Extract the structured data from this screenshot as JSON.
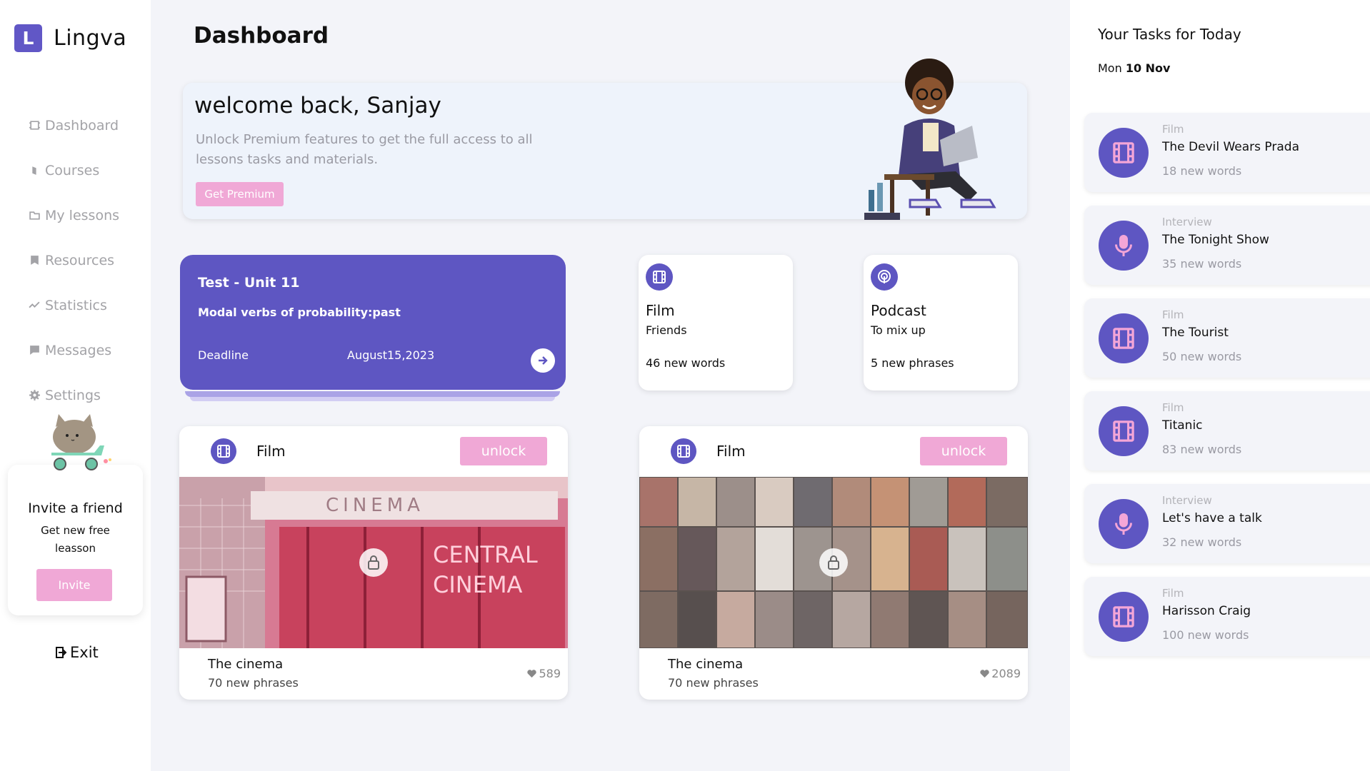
{
  "brand": {
    "letter": "L",
    "name": "Lingva"
  },
  "nav": [
    {
      "label": "Dashboard",
      "icon": "dashboard-icon"
    },
    {
      "label": "Courses",
      "icon": "courses-icon"
    },
    {
      "label": "My lessons",
      "icon": "folder-icon"
    },
    {
      "label": "Resources",
      "icon": "bookmark-icon"
    },
    {
      "label": "Statistics",
      "icon": "chart-icon"
    },
    {
      "label": "Messages",
      "icon": "message-icon"
    },
    {
      "label": "Settings",
      "icon": "gear-icon"
    }
  ],
  "invite": {
    "title": "Invite a friend",
    "subtitle": "Get new free leasson",
    "button": "Invite"
  },
  "exit_label": "Exit",
  "page_title": "Dashboard",
  "welcome": {
    "title": "welcome back, Sanjay",
    "text": "Unlock Premium features to get the full access to all lessons tasks and materials.",
    "button": "Get Premium"
  },
  "test_card": {
    "title": "Test - Unit 11",
    "subtitle": "Modal verbs of probability:past",
    "deadline_label": "Deadline",
    "deadline_date": "August15,2023"
  },
  "mini_cards": [
    {
      "title": "Film",
      "subtitle": "Friends",
      "count": "46 new words",
      "icon": "film-icon"
    },
    {
      "title": "Podcast",
      "subtitle": "To mix up",
      "count": "5 new phrases",
      "icon": "podcast-icon"
    }
  ],
  "film_cards": [
    {
      "label": "Film",
      "unlock": "unlock",
      "title": "The cinema",
      "subtitle": "70 new phrases",
      "likes": "589",
      "image_text_1": "CINEMA",
      "image_text_2": "CENTRAL",
      "image_text_3": "CINEMA"
    },
    {
      "label": "Film",
      "unlock": "unlock",
      "title": "The cinema",
      "subtitle": "70 new phrases",
      "likes": "2089"
    }
  ],
  "tasks_panel": {
    "title": "Your Tasks for Today",
    "date_prefix": "Mon",
    "date_bold": "10 Nov"
  },
  "tasks": [
    {
      "category": "Film",
      "name": "The Devil Wears Prada",
      "words": "18 new words",
      "icon": "film-icon"
    },
    {
      "category": "Interview",
      "name": "The Tonight Show",
      "words": "35 new words",
      "icon": "microphone-icon"
    },
    {
      "category": "Film",
      "name": "The Tourist",
      "words": "50 new words",
      "icon": "film-icon"
    },
    {
      "category": "Film",
      "name": "Titanic",
      "words": "83 new words",
      "icon": "film-icon"
    },
    {
      "category": "Interview",
      "name": "Let's have a talk",
      "words": "32 new words",
      "icon": "microphone-icon"
    },
    {
      "category": "Film",
      "name": "Harisson Craig",
      "words": "100 new words",
      "icon": "film-icon"
    }
  ],
  "colors": {
    "accent": "#5e56c2",
    "pink": "#f0a8d6",
    "icon_pink": "#f4a6d7"
  }
}
